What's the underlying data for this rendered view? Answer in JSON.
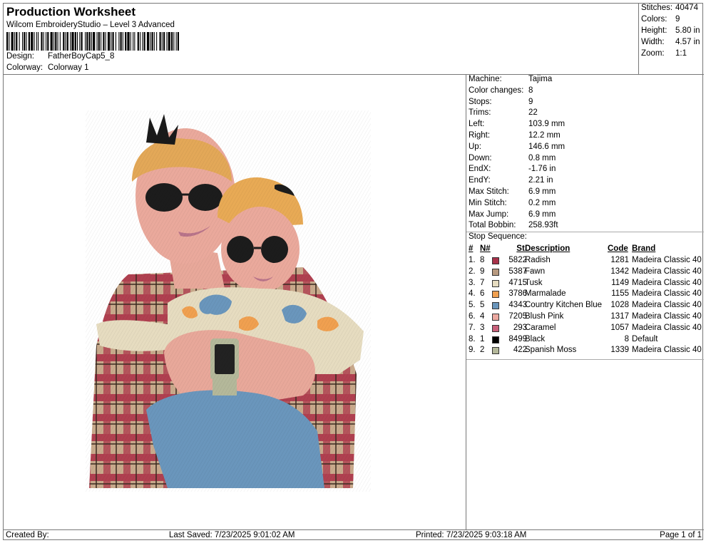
{
  "header": {
    "title": "Production Worksheet",
    "subtitle": "Wilcom EmbroideryStudio – Level 3 Advanced",
    "design_label": "Design:",
    "design_value": "FatherBoyCap5_8",
    "colorway_label": "Colorway:",
    "colorway_value": "Colorway 1"
  },
  "stats": {
    "stitches_label": "Stitches:",
    "stitches_value": "40474",
    "colors_label": "Colors:",
    "colors_value": "9",
    "height_label": "Height:",
    "height_value": "5.80 in",
    "width_label": "Width:",
    "width_value": "4.57 in",
    "zoom_label": "Zoom:",
    "zoom_value": "1:1"
  },
  "props": [
    {
      "label": "Machine:",
      "value": "Tajima"
    },
    {
      "label": "Color changes:",
      "value": "8"
    },
    {
      "label": "Stops:",
      "value": "9"
    },
    {
      "label": "Trims:",
      "value": "22"
    },
    {
      "label": "Left:",
      "value": "103.9 mm"
    },
    {
      "label": "Right:",
      "value": "12.2 mm"
    },
    {
      "label": "Up:",
      "value": "146.6 mm"
    },
    {
      "label": "Down:",
      "value": "0.8 mm"
    },
    {
      "label": "EndX:",
      "value": "-1.76 in"
    },
    {
      "label": "EndY:",
      "value": "2.21 in"
    },
    {
      "label": "Max Stitch:",
      "value": "6.9 mm"
    },
    {
      "label": "Min Stitch:",
      "value": "0.2 mm"
    },
    {
      "label": "Max Jump:",
      "value": "6.9 mm"
    },
    {
      "label": "Total Bobbin:",
      "value": "258.93ft"
    }
  ],
  "stop_sequence": {
    "title": "Stop Sequence:",
    "columns": {
      "num": "#",
      "n": "N#",
      "st": "St.",
      "desc": "Description",
      "code": "Code",
      "brand": "Brand"
    },
    "rows": [
      {
        "num": "1.",
        "n": "8",
        "color": "#a8324a",
        "st": "5822",
        "desc": "Radish",
        "code": "1281",
        "brand": "Madeira Classic 40"
      },
      {
        "num": "2.",
        "n": "9",
        "color": "#b89a80",
        "st": "5387",
        "desc": "Fawn",
        "code": "1342",
        "brand": "Madeira Classic 40"
      },
      {
        "num": "3.",
        "n": "7",
        "color": "#e6dcc0",
        "st": "4715",
        "desc": "Tusk",
        "code": "1149",
        "brand": "Madeira Classic 40"
      },
      {
        "num": "4.",
        "n": "6",
        "color": "#f0a050",
        "st": "3786",
        "desc": "Marmalade",
        "code": "1155",
        "brand": "Madeira Classic 40"
      },
      {
        "num": "5.",
        "n": "5",
        "color": "#6a96bc",
        "st": "4343",
        "desc": "Country Kitchen Blue",
        "code": "1028",
        "brand": "Madeira Classic 40"
      },
      {
        "num": "6.",
        "n": "4",
        "color": "#eba8a0",
        "st": "7205",
        "desc": "Blush Pink",
        "code": "1317",
        "brand": "Madeira Classic 40"
      },
      {
        "num": "7.",
        "n": "3",
        "color": "#c8607a",
        "st": "293",
        "desc": "Caramel",
        "code": "1057",
        "brand": "Madeira Classic 40"
      },
      {
        "num": "8.",
        "n": "1",
        "color": "#000000",
        "st": "8499",
        "desc": "Black",
        "code": "8",
        "brand": "Default"
      },
      {
        "num": "9.",
        "n": "2",
        "color": "#b4b89a",
        "st": "422",
        "desc": "Spanish Moss",
        "code": "1339",
        "brand": "Madeira Classic 40"
      }
    ]
  },
  "footer": {
    "created_by": "Created By:",
    "last_saved": "Last Saved: 7/23/2025 9:01:02 AM",
    "printed": "Printed: 7/23/2025 9:03:18 AM",
    "page": "Page 1 of 1"
  }
}
